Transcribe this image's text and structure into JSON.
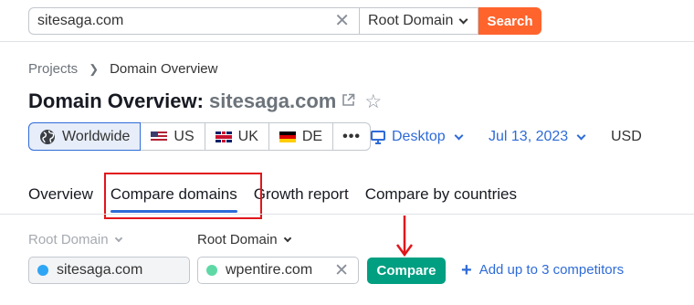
{
  "search": {
    "value": "sitesaga.com",
    "scope": "Root Domain",
    "button": "Search"
  },
  "breadcrumb": {
    "parent": "Projects",
    "current": "Domain Overview"
  },
  "title": {
    "prefix": "Domain Overview:",
    "domain": "sitesaga.com"
  },
  "regions": [
    {
      "label": "Worldwide",
      "icon": "globe-icon",
      "selected": true
    },
    {
      "label": "US",
      "icon": "flag-us-icon"
    },
    {
      "label": "UK",
      "icon": "flag-uk-icon"
    },
    {
      "label": "DE",
      "icon": "flag-de-icon"
    },
    {
      "label": "•••",
      "icon": "more-icon"
    }
  ],
  "controls": {
    "device": "Desktop",
    "date": "Jul 13, 2023",
    "currency": "USD"
  },
  "tabs": [
    {
      "label": "Overview"
    },
    {
      "label": "Compare domains",
      "active": true
    },
    {
      "label": "Growth report"
    },
    {
      "label": "Compare by countries"
    }
  ],
  "compare": {
    "scope_1": "Root Domain",
    "scope_2": "Root Domain",
    "domain_1": "sitesaga.com",
    "domain_1_color": "#2ea6f5",
    "domain_2": "wpentire.com",
    "domain_2_color": "#5ed9a6",
    "button": "Compare",
    "add_link": "Add up to 3 competitors"
  },
  "colors": {
    "accent": "#2e6bd8",
    "search_button": "#ff642d",
    "compare_button": "#009f81",
    "annotation": "#e0161b"
  }
}
